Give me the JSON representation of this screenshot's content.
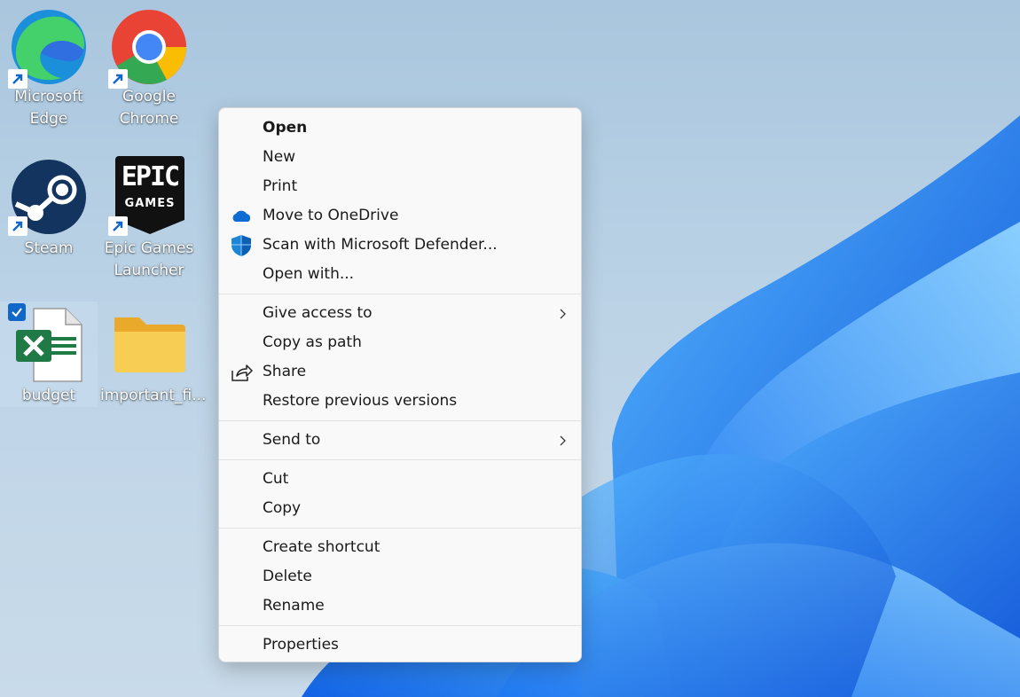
{
  "desktop": {
    "icons": [
      {
        "label": "Microsoft\nEdge",
        "icon": "edge-icon",
        "shortcut": true
      },
      {
        "label": "Google\nChrome",
        "icon": "chrome-icon",
        "shortcut": true
      },
      {
        "label": "Steam",
        "icon": "steam-icon",
        "shortcut": true
      },
      {
        "label": "Epic Games\nLauncher",
        "icon": "epic-games-icon",
        "shortcut": true
      },
      {
        "label": "budget",
        "icon": "excel-file-icon",
        "selected": true
      },
      {
        "label": "important_fi...",
        "icon": "folder-icon"
      }
    ],
    "epic_logo_text": [
      "EPIC",
      "GAMES"
    ]
  },
  "context_menu": {
    "groups": [
      [
        {
          "label": "Open",
          "bold": true
        },
        {
          "label": "New"
        },
        {
          "label": "Print"
        },
        {
          "label": "Move to OneDrive",
          "icon": "onedrive-cloud-icon"
        },
        {
          "label": "Scan with Microsoft Defender...",
          "icon": "defender-shield-icon"
        },
        {
          "label": "Open with..."
        }
      ],
      [
        {
          "label": "Give access to",
          "submenu": true
        },
        {
          "label": "Copy as path"
        },
        {
          "label": "Share",
          "icon": "share-icon"
        },
        {
          "label": "Restore previous versions"
        }
      ],
      [
        {
          "label": "Send to",
          "submenu": true
        }
      ],
      [
        {
          "label": "Cut"
        },
        {
          "label": "Copy"
        }
      ],
      [
        {
          "label": "Create shortcut"
        },
        {
          "label": "Delete"
        },
        {
          "label": "Rename"
        }
      ],
      [
        {
          "label": "Properties"
        }
      ]
    ]
  },
  "colors": {
    "accent": "#1167c8",
    "excel_green": "#1f7a45",
    "onedrive_blue": "#0f6cd3",
    "folder_yellow": "#f6c443",
    "wallpaper_blue": "#1a7cf0"
  }
}
